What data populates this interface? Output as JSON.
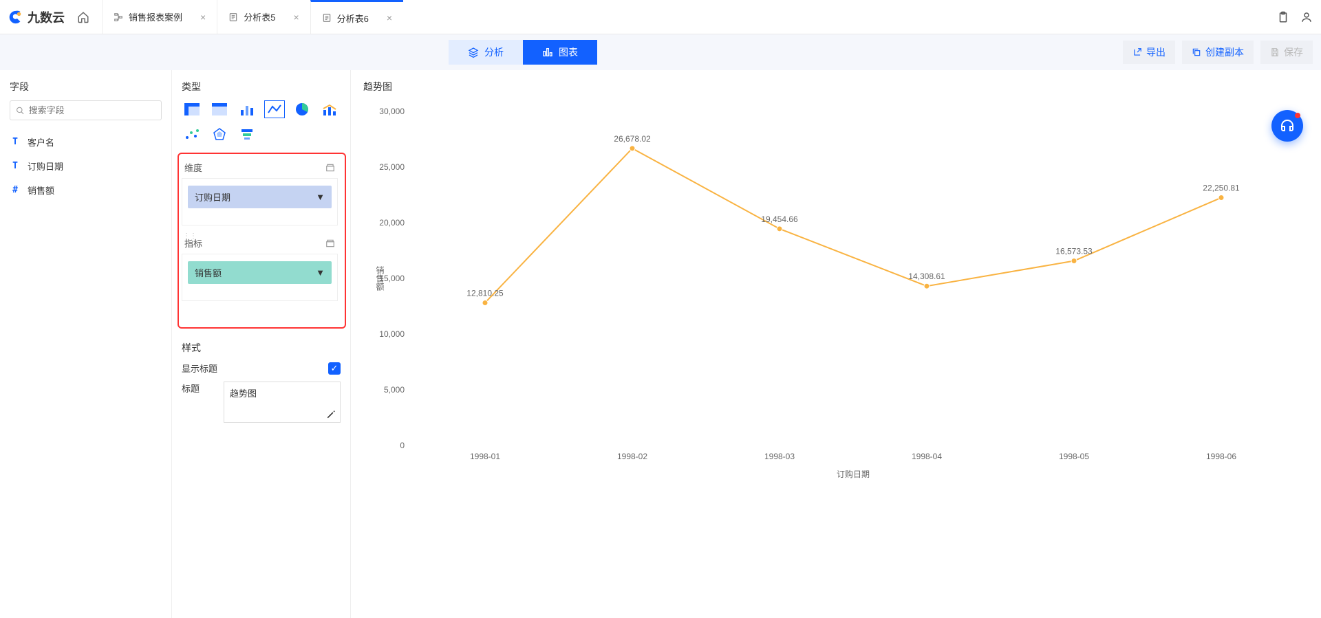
{
  "brand": "九数云",
  "tabs": [
    {
      "label": "销售报表案例",
      "active": false
    },
    {
      "label": "分析表5",
      "active": false
    },
    {
      "label": "分析表6",
      "active": true
    }
  ],
  "modes": {
    "analysis": "分析",
    "chart": "图表"
  },
  "actions": {
    "export": "导出",
    "duplicate": "创建副本",
    "save": "保存"
  },
  "fields_panel": {
    "title": "字段",
    "search_placeholder": "搜索字段",
    "items": [
      {
        "type": "T",
        "label": "客户名"
      },
      {
        "type": "T",
        "label": "订购日期"
      },
      {
        "type": "#",
        "label": "销售额"
      }
    ]
  },
  "config_panel": {
    "type_title": "类型",
    "dim_title": "维度",
    "ind_title": "指标",
    "dim_value": "订购日期",
    "ind_value": "销售额",
    "style_title": "样式",
    "show_title_label": "显示标题",
    "title_label": "标题",
    "title_value": "趋势图"
  },
  "chart_header": "趋势图",
  "chart_data": {
    "type": "line",
    "title": "趋势图",
    "xlabel": "订购日期",
    "ylabel": "销售额",
    "ylim": [
      0,
      30000
    ],
    "yticks": [
      0,
      5000,
      10000,
      15000,
      20000,
      25000,
      30000
    ],
    "ytick_labels": [
      "0",
      "5,000",
      "10,000",
      "15,000",
      "20,000",
      "25,000",
      "30,000"
    ],
    "categories": [
      "1998-01",
      "1998-02",
      "1998-03",
      "1998-04",
      "1998-05",
      "1998-06"
    ],
    "values": [
      12810.25,
      26678.02,
      19454.66,
      14308.61,
      16573.53,
      22250.81
    ],
    "value_labels": [
      "12,810.25",
      "26,678.02",
      "19,454.66",
      "14,308.61",
      "16,573.53",
      "22,250.81"
    ],
    "series_color": "#f9b342"
  }
}
